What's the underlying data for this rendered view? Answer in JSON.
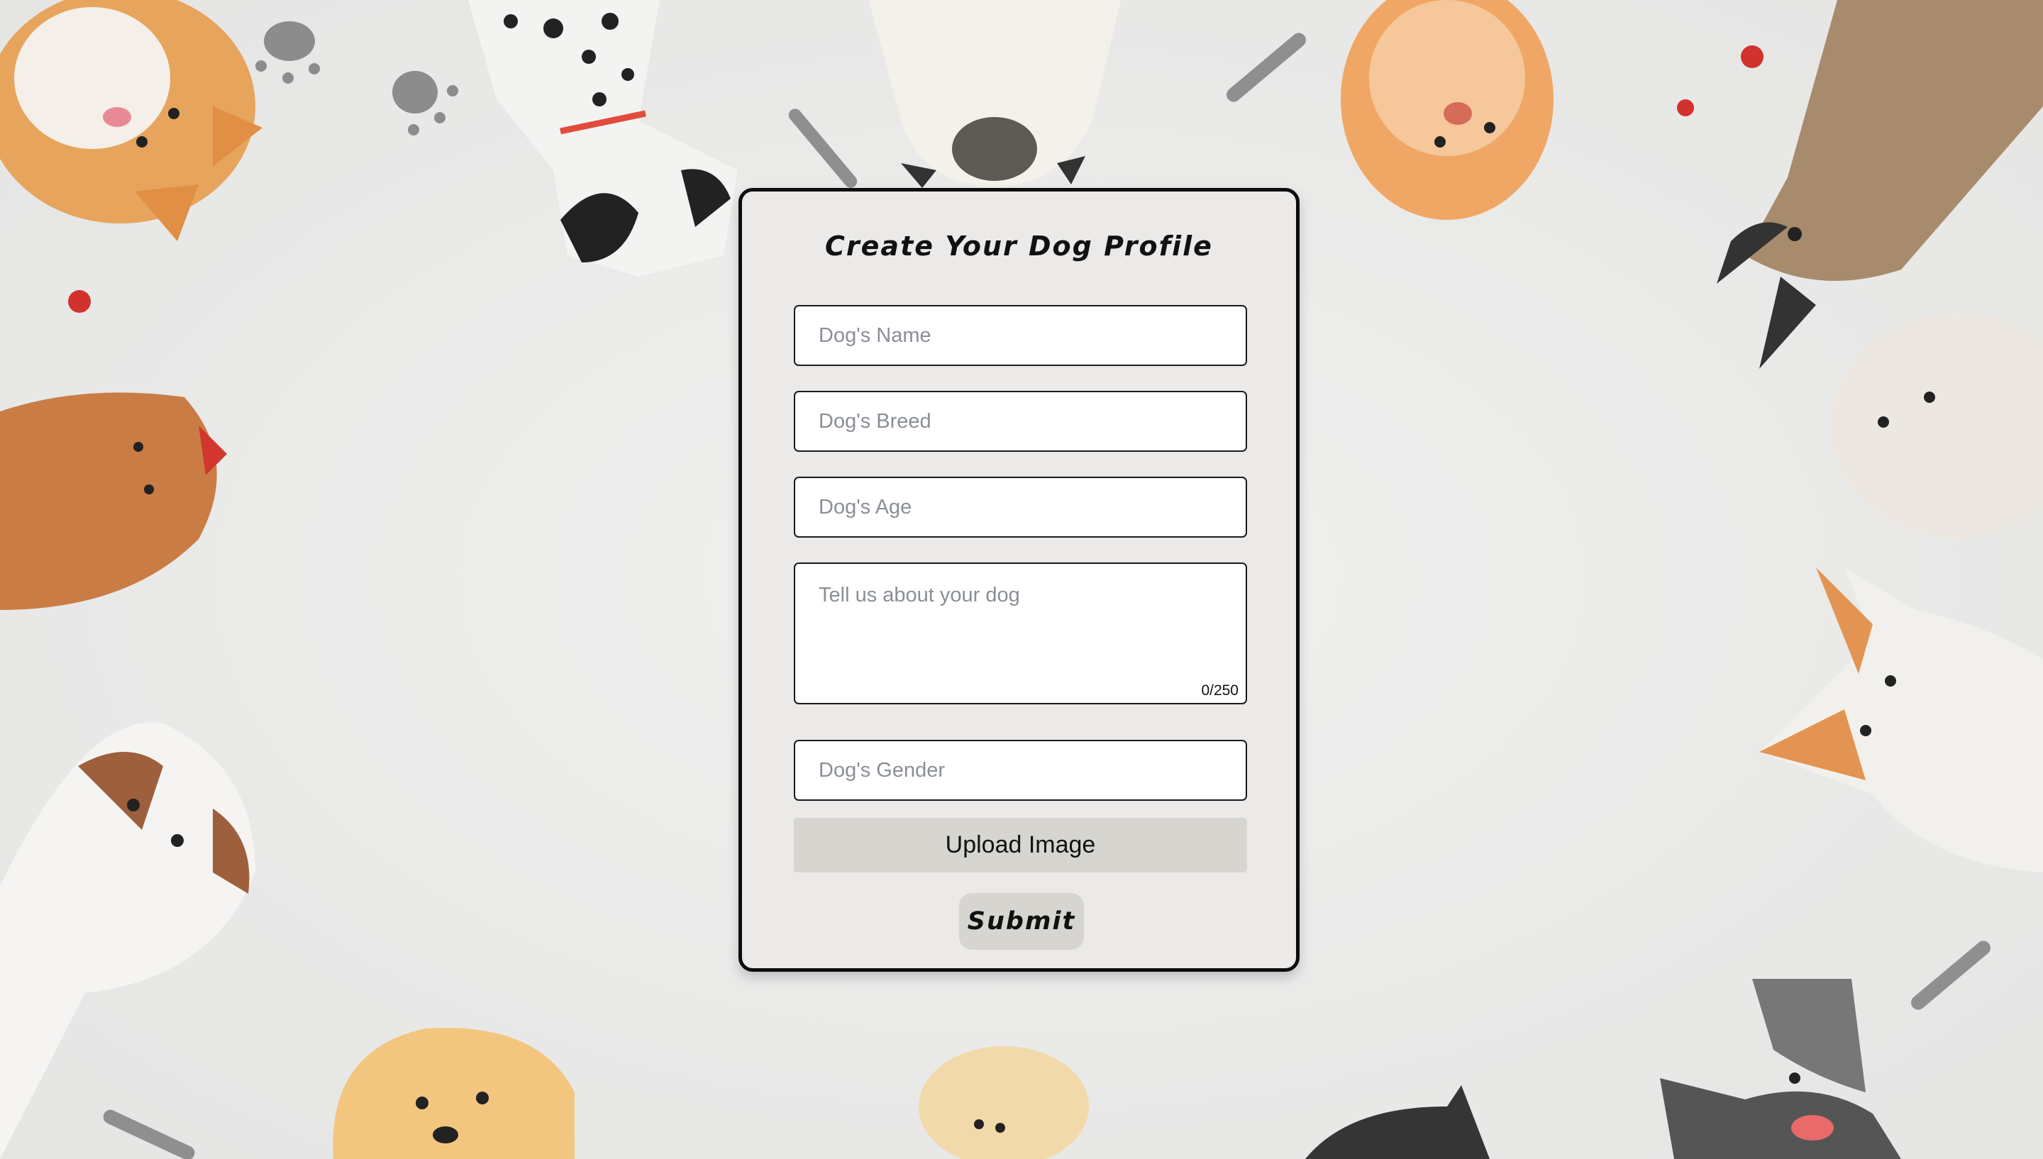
{
  "form": {
    "title": "Create Your Dog Profile",
    "name_placeholder": "Dog's Name",
    "breed_placeholder": "Dog's Breed",
    "age_placeholder": "Dog's Age",
    "about_placeholder": "Tell us about your dog",
    "about_counter": "0/250",
    "gender_placeholder": "Dog's Gender",
    "upload_label": "Upload Image",
    "submit_label": "Submit"
  },
  "colors": {
    "background": "#ebebea",
    "card": "#ebeae8",
    "card_border": "#0d0d0d",
    "button": "#d6d5d0",
    "placeholder": "#8a8f96"
  }
}
